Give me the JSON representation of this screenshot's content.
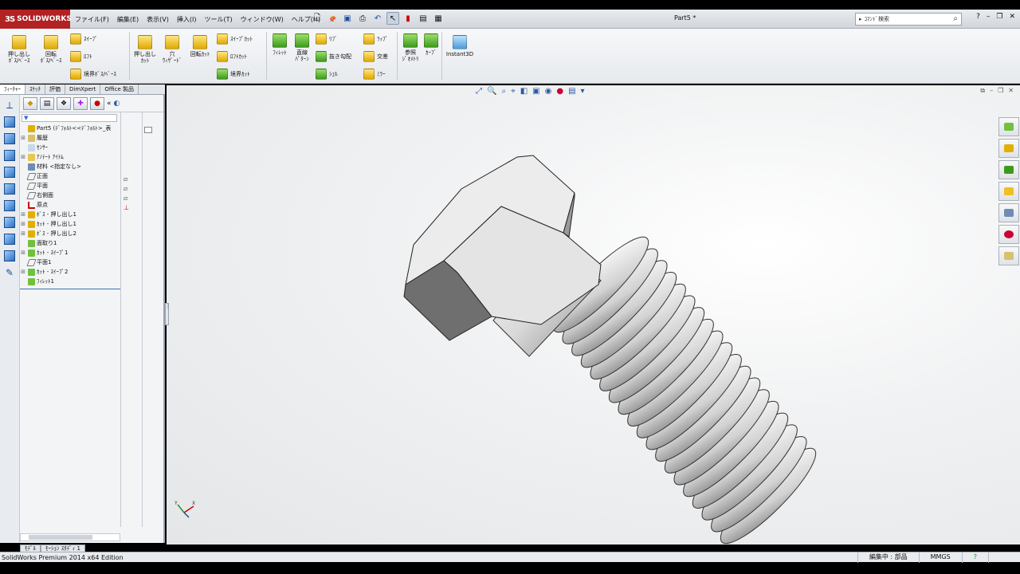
{
  "app": {
    "logo_text": "SOLIDWORKS",
    "logo_mark": "3S",
    "document_title": "Part5 *",
    "brand_color": "#b22222"
  },
  "menu": [
    "ファイル(F)",
    "編集(E)",
    "表示(V)",
    "挿入(I)",
    "ツール(T)",
    "ウィンドウ(W)",
    "ヘルプ(H)"
  ],
  "search": {
    "placeholder": "ｺﾏﾝﾄﾞ検索"
  },
  "ribbon": {
    "extrude_boss": "押し出し\nﾎﾞｽ/ﾍﾞｰｽ",
    "revolve_boss": "回転\nﾎﾞｽ/ﾍﾞｰｽ",
    "sweep": "ｽｲｰﾌﾟ",
    "loft": "ﾛﾌﾄ",
    "boundary_boss": "境界ﾎﾞｽ/ﾍﾞｰｽ",
    "extrude_cut": "押し出し\nｶｯﾄ",
    "hole_wizard": "穴\nｳｨｻﾞｰﾄﾞ",
    "revolve_cut": "回転ｶｯﾄ",
    "sweep_cut": "ｽｲｰﾌﾟｶｯﾄ",
    "loft_cut": "ﾛﾌﾄｶｯﾄ",
    "boundary_cut": "境界ｶｯﾄ",
    "fillet": "ﾌｨﾚｯﾄ",
    "linear_pattern": "直線\nﾊﾟﾀｰﾝ",
    "rib": "ﾘﾌﾞ",
    "draft": "抜き勾配",
    "shell": "ｼｪﾙ",
    "wrap": "ﾗｯﾌﾟ",
    "intersect": "交差",
    "mirror": "ﾐﾗｰ",
    "ref_geometry": "参照\nｼﾞｵﾒﾄﾘ",
    "curves": "ｶｰﾌﾞ",
    "instant3d": "Instant3D"
  },
  "tabs": [
    "ﾌｨｰﾁｬｰ",
    "ｽｹｯﾁ",
    "評価",
    "DimXpert",
    "Office 製品"
  ],
  "tree": [
    {
      "label": "Part5 (ﾃﾞﾌｫﾙﾄ<<ﾃﾞﾌｫﾙﾄ>_表",
      "icon": "part-icon"
    },
    {
      "label": "履歴",
      "icon": "history-icon"
    },
    {
      "label": "ｾﾝｻｰ",
      "icon": "sensor-icon"
    },
    {
      "label": "ｱﾉﾃｰﾄ ｱｲﾃﾑ",
      "icon": "annotation-icon"
    },
    {
      "label": "材料 <指定なし>",
      "icon": "material-icon"
    },
    {
      "label": "正面",
      "icon": "plane-icon"
    },
    {
      "label": "平面",
      "icon": "plane-icon"
    },
    {
      "label": "右側面",
      "icon": "plane-icon"
    },
    {
      "label": "原点",
      "icon": "origin-icon"
    },
    {
      "label": "ﾎﾞｽ - 押し出し1",
      "icon": "boss-extrude-icon"
    },
    {
      "label": "ｶｯﾄ - 押し出し1",
      "icon": "cut-extrude-icon"
    },
    {
      "label": "ﾎﾞｽ - 押し出し2",
      "icon": "boss-extrude-icon"
    },
    {
      "label": "面取り1",
      "icon": "chamfer-icon"
    },
    {
      "label": "ｶｯﾄ - ｽｲｰﾌﾟ1",
      "icon": "cut-sweep-icon"
    },
    {
      "label": "平面1",
      "icon": "plane-icon"
    },
    {
      "label": "ｶｯﾄ - ｽｲｰﾌﾟ2",
      "icon": "cut-sweep-icon"
    },
    {
      "label": "ﾌｨﾚｯﾄ1",
      "icon": "fillet-icon"
    }
  ],
  "bottom_tabs": [
    "ﾓﾃﾞﾙ",
    "ﾓｰｼｮﾝ ｽﾀﾃﾞｨ 1"
  ],
  "status": {
    "edition": "SolidWorks Premium 2014 x64 Edition",
    "mode": "編集中 : 部品",
    "units": "MMGS"
  }
}
